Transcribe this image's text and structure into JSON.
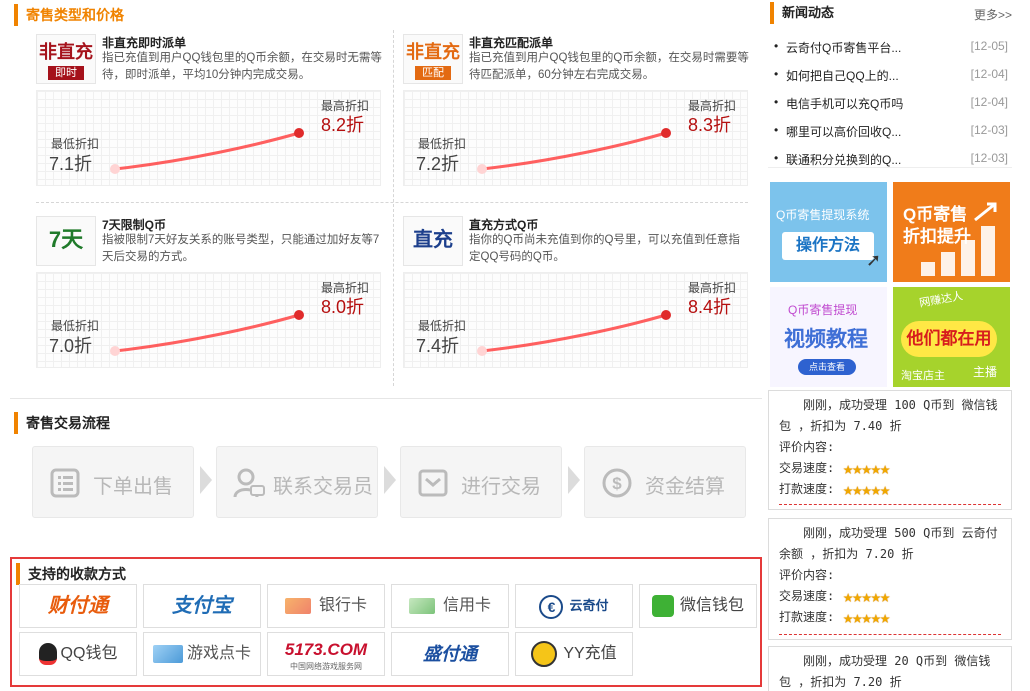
{
  "sections": {
    "types_title": "寄售类型和价格",
    "flow_title": "寄售交易流程",
    "payment_title": "支持的收款方式"
  },
  "graph_labels": {
    "low": "最低折扣",
    "high": "最高折扣"
  },
  "cards": [
    {
      "logo_big": "非直充",
      "logo_small": "即时",
      "name": "非直充即时派单",
      "desc": "指已充值到用户QQ钱包里的Q币余额，在交易时无需等待，即时派单，平均10分钟内完成交易。",
      "low": "7.1折",
      "high": "8.2折"
    },
    {
      "logo_big": "非直充",
      "logo_small": "匹配",
      "name": "非直充匹配派单",
      "desc": "指已充值到用户QQ钱包里的Q币余额，在交易时需要等待匹配派单，60分钟左右完成交易。",
      "low": "7.2折",
      "high": "8.3折"
    },
    {
      "logo_big": "7天",
      "logo_small": "",
      "name": "7天限制Q币",
      "desc": "指被限制7天好友关系的账号类型，只能通过加好友等7天后交易的方式。",
      "low": "7.0折",
      "high": "8.0折"
    },
    {
      "logo_big": "直充",
      "logo_small": "",
      "name": "直充方式Q币",
      "desc": "指你的Q币尚未充值到你的Q号里，可以充值到任意指定QQ号码的Q币。",
      "low": "7.4折",
      "high": "8.4折"
    }
  ],
  "steps": [
    "下单出售",
    "联系交易员",
    "进行交易",
    "资金结算"
  ],
  "payments": [
    {
      "label": "财付通",
      "icon": "tenpay-logo",
      "color": "#e85c0d"
    },
    {
      "label": "支付宝",
      "icon": "alipay-logo",
      "color": "#1f6cb5"
    },
    {
      "label": "银行卡",
      "icon": "bank-card-icon",
      "color": "#555555"
    },
    {
      "label": "信用卡",
      "icon": "credit-card-icon",
      "color": "#555555"
    },
    {
      "label": "云奇付",
      "icon": "yunqifu-logo",
      "color": "#1a4a8a"
    },
    {
      "label": "微信钱包",
      "icon": "wechat-wallet-icon",
      "color": "#444444"
    },
    {
      "label": "QQ钱包",
      "icon": "qq-penguin-icon",
      "color": "#444444"
    },
    {
      "label": "游戏点卡",
      "icon": "game-card-icon",
      "color": "#555555"
    },
    {
      "label": "5173.COM",
      "icon": "5173-logo",
      "color": "#c8102e",
      "sub": "中国网络游戏服务网"
    },
    {
      "label": "盛付通",
      "icon": "shengpay-logo",
      "color": "#1b4fa0"
    },
    {
      "label": "YY充值",
      "icon": "yy-bear-icon",
      "color": "#444444"
    }
  ],
  "news": {
    "title": "新闻动态",
    "more": "更多>>",
    "items": [
      {
        "title": "云奇付Q币寄售平台...",
        "date": "[12-05]"
      },
      {
        "title": "如何把自己QQ上的...",
        "date": "[12-04]"
      },
      {
        "title": "电信手机可以充Q币吗",
        "date": "[12-04]"
      },
      {
        "title": "哪里可以高价回收Q...",
        "date": "[12-03]"
      },
      {
        "title": "联通积分兑换到的Q...",
        "date": "[12-03]"
      }
    ]
  },
  "promos": {
    "p1_top": "Q币寄售提现系统",
    "p1_btn": "操作方法",
    "p2_line1": "Q币寄售",
    "p2_line2": "折扣提升",
    "p3_top": "Q币寄售提现",
    "p3_main": "视频教程",
    "p3_btn": "点击查看",
    "p4_main": "他们都在用",
    "p4_a": "网赚达人",
    "p4_b": "淘宝店主",
    "p4_c": "主播"
  },
  "reviews": [
    {
      "body": "刚刚，成功受理 100 Q币到 微信钱包 ，折扣为 7.40 折",
      "comment": "评价内容:",
      "speed": "交易速度:",
      "pay": "打款速度:",
      "rating_trade": 5,
      "rating_pay": 5
    },
    {
      "body": "刚刚，成功受理 500 Q币到 云奇付余额 ，折扣为 7.20 折",
      "comment": "评价内容:",
      "speed": "交易速度:",
      "pay": "打款速度:",
      "rating_trade": 5,
      "rating_pay": 5
    },
    {
      "body": "刚刚，成功受理 20 Q币到 微信钱包 ，折扣为 7.20 折"
    }
  ]
}
